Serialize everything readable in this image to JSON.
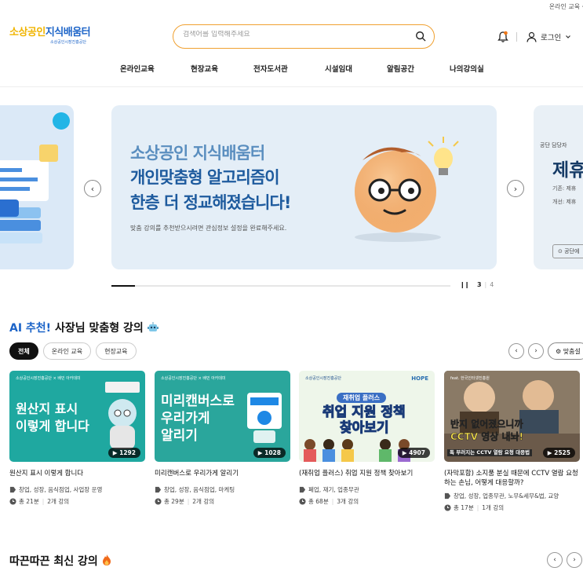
{
  "topbar": {
    "util_text": "온라인 교육 수"
  },
  "header": {
    "logo_main_a": "소상공인",
    "logo_main_b": "지식배움터",
    "logo_sub": "소상공인시장진흥공단",
    "search_placeholder": "검색어를 입력해주세요",
    "login_label": "로그인"
  },
  "nav": {
    "items": [
      "온라인교육",
      "현장교육",
      "전자도서관",
      "시설임대",
      "알림공간",
      "나의강의실"
    ]
  },
  "carousel": {
    "main": {
      "line1": "소상공인 지식배움터",
      "line2": "개인맞춤형 알고리즘이",
      "line3": "한층 더 정교해졌습니다!",
      "sub": "맞춤 강의를 추천받으시려면 관심정보 설정을 완료해주세요."
    },
    "right": {
      "line1": "공단 담당자",
      "title": "제휴",
      "line2": "기존: 제휴",
      "line3": "개선: 제휴",
      "button": "공단에"
    },
    "progress_fraction": 0.07,
    "current": "3",
    "total": "4"
  },
  "ai_section": {
    "title_ai": "AI 추천!",
    "title_rest": " 사장님 맞춤형 강의",
    "chips": [
      "전체",
      "온라인 교육",
      "현장교육"
    ],
    "settings_label": "맞춤설"
  },
  "courses": [
    {
      "thumb_brand": "소상공인시장진흥공단 × 배민 아카데미",
      "thumb_text": [
        "원산지 표시",
        "이렇게 합니다"
      ],
      "views": "1292",
      "title": "원산지 표시 이렇게 합니다",
      "tags": "창업, 성장, 음식점업, 사업장 운영",
      "duration": "총 21분",
      "count": "2개 강의"
    },
    {
      "thumb_brand": "소상공인시장진흥공단 × 배민 아카데미",
      "thumb_text": [
        "미리캔버스로",
        "우리가게",
        "알리기"
      ],
      "views": "1028",
      "title": "미리캔버스로 우리가게 알리기",
      "tags": "창업, 성장, 음식점업, 마케팅",
      "duration": "총 29분",
      "count": "2개 강의"
    },
    {
      "thumb_brand": "소상공인시장진흥공단",
      "thumb_text": [
        "재취업 플러스",
        "취업 지원 정책",
        "찾아보기"
      ],
      "views": "4907",
      "title": "(재취업 플러스) 취업 지원 정책 찾아보기",
      "tags": "폐업, 재기, 업종무관",
      "duration": "총 68분",
      "count": "3개 강의"
    },
    {
      "thumb_brand": "feat. 한국인터넷진흥원",
      "thumb_text": [
        "반지 없어졌으니까",
        "CCTV 영상 내놔!",
        "독 부러지는 CCTV 열람 요청 대응법"
      ],
      "views": "2525",
      "title": "(자막포함) 소지품 분실 때문에 CCTV 열람 요청하는 손님, 어떻게 대응할까?",
      "tags": "창업, 성장, 업종무관, 노무&세무&법, 교양",
      "duration": "총 17분",
      "count": "1개 강의"
    }
  ],
  "latest_section": {
    "title": "따끈따끈 최신 강의"
  }
}
